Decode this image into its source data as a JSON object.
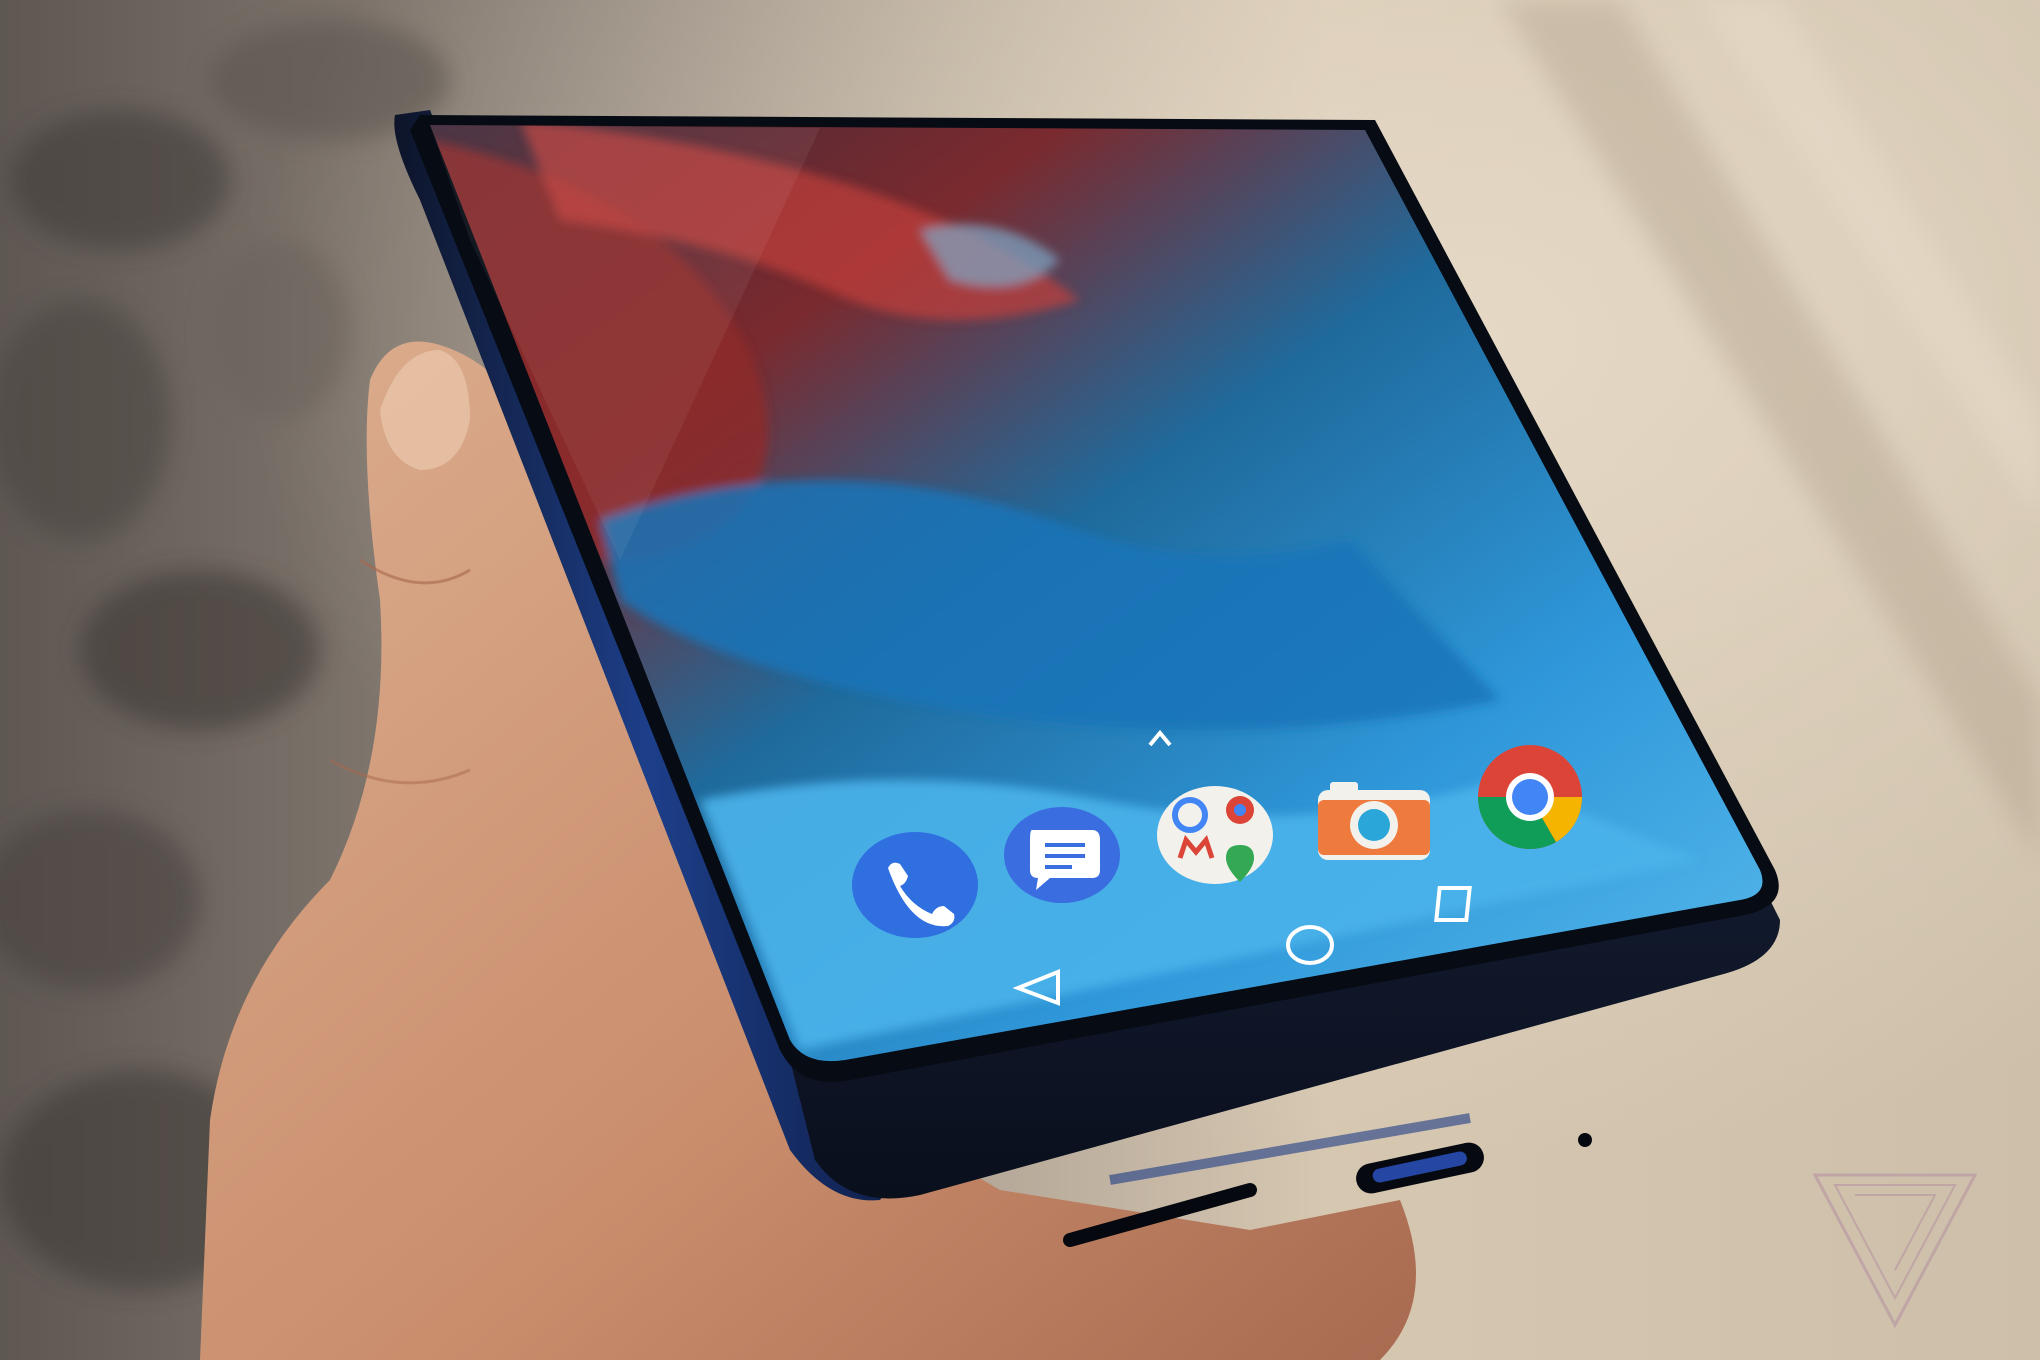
{
  "scene": {
    "subject": "hand-holding-smartphone",
    "colors": {
      "background_light": "#d9cbb6",
      "background_dark": "#6f6863",
      "skin": "#d29b7d",
      "phone_body": "#10182c",
      "wallpaper_blue": "#2f8fd0",
      "wallpaper_red": "#8a2c2a"
    }
  },
  "homescreen": {
    "app_drawer_hint_icon": "chevron-up-icon",
    "dock": [
      {
        "icon": "phone-app-icon",
        "color": "#2f6fe0"
      },
      {
        "icon": "messages-app-icon",
        "color": "#3a6ee0"
      },
      {
        "icon": "google-apps-folder-icon",
        "color": "#f3f1ec"
      },
      {
        "icon": "camera-app-icon",
        "color": "#ef7a3d"
      },
      {
        "icon": "chrome-app-icon",
        "color": "#db4437"
      }
    ],
    "nav_bar": [
      {
        "icon": "back-nav-icon"
      },
      {
        "icon": "home-nav-icon"
      },
      {
        "icon": "recents-nav-icon"
      }
    ]
  },
  "watermark": {
    "icon": "verge-logo-icon"
  }
}
